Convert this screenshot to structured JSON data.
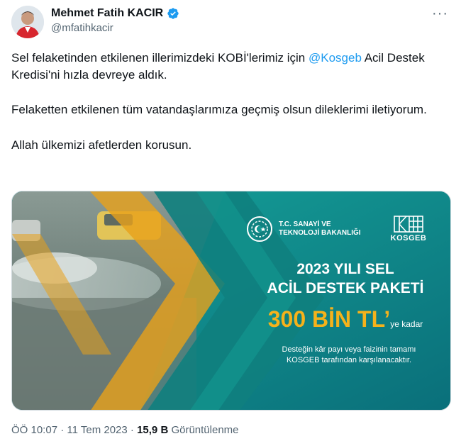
{
  "author": {
    "name": "Mehmet Fatih KACIR",
    "handle": "@mfatihkacir"
  },
  "more_icon": "more-horizontal-icon",
  "tweet": {
    "line1_before": "Sel felaketinden etkilenen illerimizdeki KOBİ'lerimiz için ",
    "mention": "@Kosgeb",
    "line1_after": " Acil Destek Kredisi'ni hızla devreye aldık.",
    "paragraph2": "Felaketten etkilenen tüm vatandaşlarımıza geçmiş olsun dileklerimi iletiyorum.",
    "paragraph3": "Allah ülkemizi afetlerden korusun."
  },
  "media": {
    "ministry_line1": "T.C. SANAYİ VE",
    "ministry_line2": "TEKNOLOJİ BAKANLIĞI",
    "kosgeb_label": "KOSGEB",
    "headline_line1": "2023 YILI SEL",
    "headline_line2": "ACİL DESTEK PAKETİ",
    "amount": "300 BİN TL’",
    "amount_suffix": "ye kadar",
    "note_line1": "Desteğin kâr payı veya faizinin tamamı",
    "note_line2": "KOSGEB tarafından karşılanacaktır."
  },
  "meta": {
    "time": "ÖÖ 10:07",
    "separator": "·",
    "date": "11 Tem 2023",
    "views_count": "15,9 B",
    "views_label": "Görüntülenme"
  },
  "colors": {
    "link": "#1d9bf0",
    "verified": "#1d9bf0",
    "secondary_text": "#536471",
    "banner_teal": "#0e8a86",
    "banner_accent": "#f5b21b"
  }
}
